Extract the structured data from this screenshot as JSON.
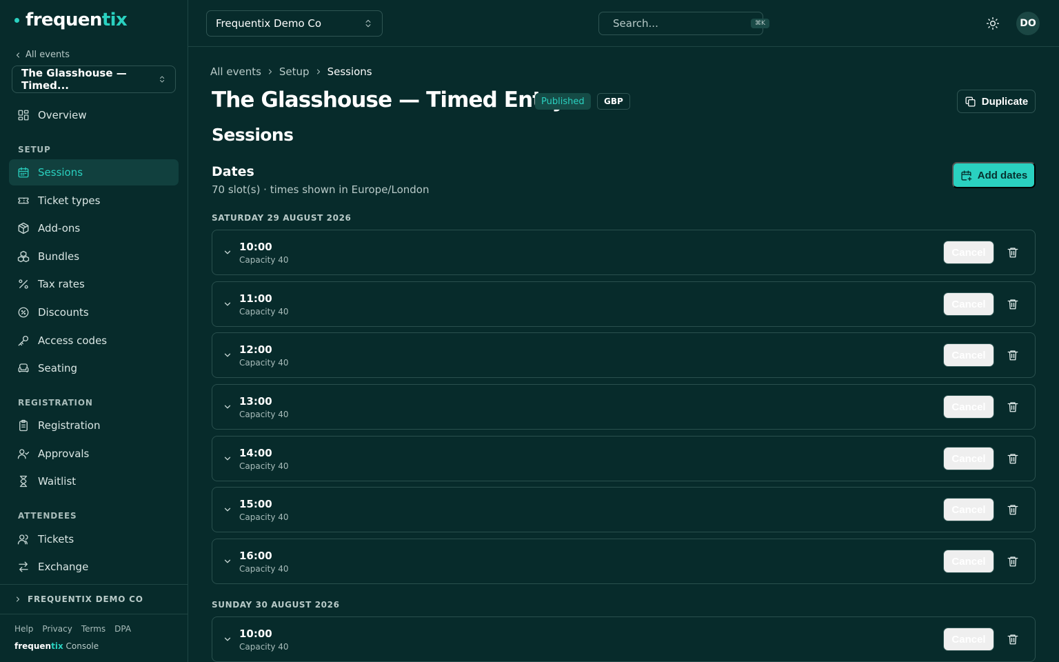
{
  "brand": {
    "name_part1": "frequen",
    "name_part2": "tix",
    "console_part1": "frequen",
    "console_part2": "tix",
    "console_suffix": " Console",
    "accent": "#2ad1c0"
  },
  "sidebar": {
    "back_label": "All events",
    "event_name": "The Glasshouse — Timed...",
    "overview": "Overview",
    "sections": [
      {
        "title": "SETUP",
        "items": [
          "Sessions",
          "Ticket types",
          "Add-ons",
          "Bundles",
          "Tax rates",
          "Discounts",
          "Access codes",
          "Seating"
        ]
      },
      {
        "title": "REGISTRATION",
        "items": [
          "Registration",
          "Approvals",
          "Waitlist"
        ]
      },
      {
        "title": "ATTENDEES",
        "items": [
          "Tickets",
          "Exchange"
        ]
      }
    ],
    "active_item": "Sessions",
    "org_label": "FREQUENTIX DEMO CO",
    "footer_links": [
      "Help",
      "Privacy",
      "Terms",
      "DPA"
    ]
  },
  "topbar": {
    "org_name": "Frequentix Demo Co",
    "search_placeholder": "Search...",
    "search_shortcut": "⌘K",
    "avatar_initials": "DO"
  },
  "page": {
    "breadcrumb": [
      "All events",
      "Setup",
      "Sessions"
    ],
    "title": "The Glasshouse — Timed Entry",
    "status_badge": "Published",
    "currency_badge": "GBP",
    "duplicate_label": "Duplicate",
    "section_title": "Sessions",
    "dates_title": "Dates",
    "dates_subtitle": "70 slot(s) · times shown in Europe/London",
    "add_dates_label": "Add dates",
    "cancel_label": "Cancel",
    "days": [
      {
        "label": "SATURDAY 29 AUGUST 2026",
        "slots": [
          {
            "time": "10:00",
            "capacity": "Capacity 40"
          },
          {
            "time": "11:00",
            "capacity": "Capacity 40"
          },
          {
            "time": "12:00",
            "capacity": "Capacity 40"
          },
          {
            "time": "13:00",
            "capacity": "Capacity 40"
          },
          {
            "time": "14:00",
            "capacity": "Capacity 40"
          },
          {
            "time": "15:00",
            "capacity": "Capacity 40"
          },
          {
            "time": "16:00",
            "capacity": "Capacity 40"
          }
        ]
      },
      {
        "label": "SUNDAY 30 AUGUST 2026",
        "slots": [
          {
            "time": "10:00",
            "capacity": "Capacity 40"
          }
        ]
      }
    ]
  }
}
